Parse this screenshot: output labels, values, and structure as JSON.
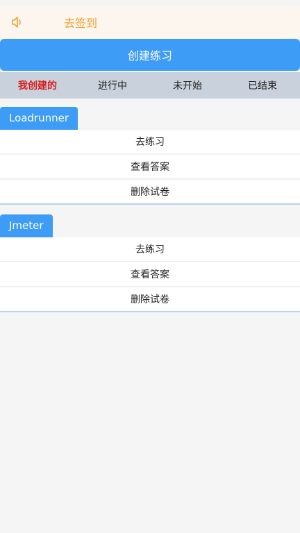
{
  "notice": {
    "icon": "speaker-icon",
    "text": "去签到"
  },
  "create_button": {
    "label": "创建练习"
  },
  "tabs": [
    {
      "label": "我创建的",
      "active": true
    },
    {
      "label": "进行中",
      "active": false
    },
    {
      "label": "未开始",
      "active": false
    },
    {
      "label": "已结束",
      "active": false
    }
  ],
  "cards": [
    {
      "title": "Loadrunner",
      "actions": [
        "去练习",
        "查看答案",
        "删除试卷"
      ]
    },
    {
      "title": "Jmeter",
      "actions": [
        "去练习",
        "查看答案",
        "删除试卷"
      ]
    }
  ],
  "colors": {
    "accent": "#3d9cf5",
    "notice_text": "#f0a030",
    "active_tab": "#d81e1e"
  }
}
